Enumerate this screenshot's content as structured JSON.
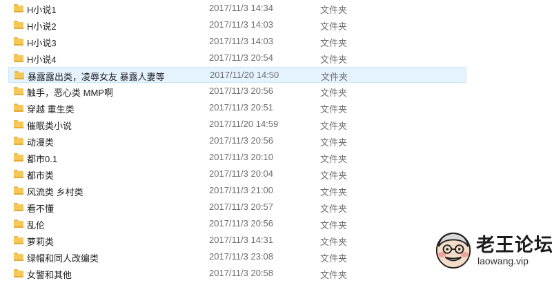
{
  "files": [
    {
      "name": "H小说1",
      "date": "2017/11/3 14:34",
      "type": "文件夹",
      "selected": false
    },
    {
      "name": "H小说2",
      "date": "2017/11/3 14:03",
      "type": "文件夹",
      "selected": false
    },
    {
      "name": "H小说3",
      "date": "2017/11/3 14:03",
      "type": "文件夹",
      "selected": false
    },
    {
      "name": "H小说4",
      "date": "2017/11/3 20:54",
      "type": "文件夹",
      "selected": false
    },
    {
      "name": "暴露露出类，凌辱女友 暴露人妻等",
      "date": "2017/11/20 14:50",
      "type": "文件夹",
      "selected": true
    },
    {
      "name": "触手，恶心类 MMP啊",
      "date": "2017/11/3 20:56",
      "type": "文件夹",
      "selected": false
    },
    {
      "name": "穿越 重生类",
      "date": "2017/11/3 20:51",
      "type": "文件夹",
      "selected": false
    },
    {
      "name": "催眠类小说",
      "date": "2017/11/20 14:59",
      "type": "文件夹",
      "selected": false
    },
    {
      "name": "动漫类",
      "date": "2017/11/3 20:56",
      "type": "文件夹",
      "selected": false
    },
    {
      "name": "都市0.1",
      "date": "2017/11/3 20:10",
      "type": "文件夹",
      "selected": false
    },
    {
      "name": "都市类",
      "date": "2017/11/3 20:04",
      "type": "文件夹",
      "selected": false
    },
    {
      "name": "风流类 乡村类",
      "date": "2017/11/3 21:00",
      "type": "文件夹",
      "selected": false
    },
    {
      "name": "看不懂",
      "date": "2017/11/3 20:57",
      "type": "文件夹",
      "selected": false
    },
    {
      "name": "乱伦",
      "date": "2017/11/3 20:56",
      "type": "文件夹",
      "selected": false
    },
    {
      "name": "萝莉类",
      "date": "2017/11/3 14:31",
      "type": "文件夹",
      "selected": false
    },
    {
      "name": "绿帽和同人改编类",
      "date": "2017/11/3 23:08",
      "type": "文件夹",
      "selected": false
    },
    {
      "name": "女警和其他",
      "date": "2017/11/3 20:58",
      "type": "文件夹",
      "selected": false
    }
  ],
  "icons": {
    "row_icon": "folder-icon",
    "logo_icon": "old-man-face-icon"
  },
  "colors": {
    "folder": "#f5c857",
    "selection": "#e5f3ff"
  },
  "watermark": {
    "title": "老王论坛",
    "url": "laowang.vip"
  }
}
